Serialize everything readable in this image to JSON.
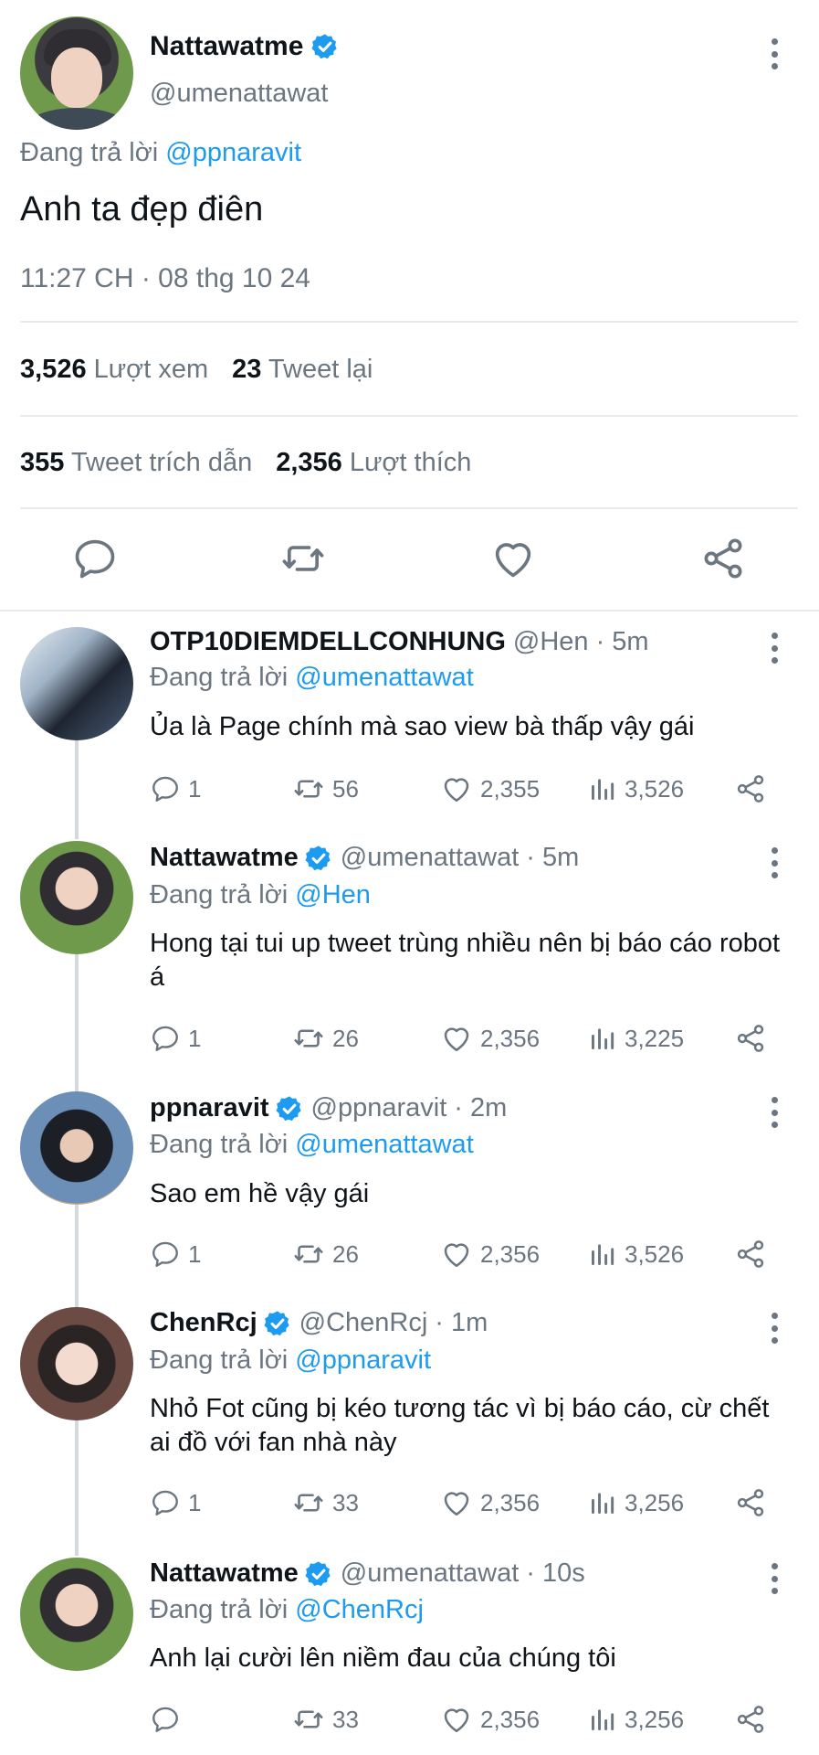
{
  "main_tweet": {
    "name": "Nattawatme",
    "handle": "@umenattawat",
    "reply_prefix": "Đang trả lời",
    "reply_to": "@ppnaravit",
    "text": "Anh ta đẹp điên",
    "timestamp": "11:27 CH · 08 thg 10 24",
    "views_count": "3,526",
    "views_label": "Lượt xem",
    "retweets_count": "23",
    "retweets_label": "Tweet lại",
    "quotes_count": "355",
    "quotes_label": "Tweet trích dẫn",
    "likes_count": "2,356",
    "likes_label": "Lượt thích",
    "actions": [
      "reply-icon",
      "retweet-icon",
      "like-icon",
      "share-icon"
    ]
  },
  "replies": [
    {
      "name": "OTP10DIEMDELLCONHUNG",
      "verified": false,
      "handle": "@Hen",
      "time": "· 5m",
      "reply_prefix": "Đang trả lời",
      "reply_to": "@umenattawat",
      "text": "Ủa là Page chính mà sao view bà thấp vậy gái",
      "replies": "1",
      "retweets": "56",
      "likes": "2,355",
      "views": "3,526"
    },
    {
      "name": "Nattawatme",
      "verified": true,
      "handle": "@umenattawat",
      "time": "· 5m",
      "reply_prefix": "Đang trả lời",
      "reply_to": "@Hen",
      "text": "Hong tại tui up tweet trùng nhiều nên bị báo cáo robot á",
      "replies": "1",
      "retweets": "26",
      "likes": "2,356",
      "views": "3,225"
    },
    {
      "name": "ppnaravit",
      "verified": true,
      "handle": "@ppnaravit",
      "time": "· 2m",
      "reply_prefix": "Đang trả lời",
      "reply_to": "@umenattawat",
      "text": "Sao em hề vậy gái",
      "replies": "1",
      "retweets": "26",
      "likes": "2,356",
      "views": "3,526"
    },
    {
      "name": "ChenRcj",
      "verified": true,
      "handle": "@ChenRcj",
      "time": "· 1m",
      "reply_prefix": "Đang trả lời",
      "reply_to": "@ppnaravit",
      "text": "Nhỏ Fot cũng bị kéo tương tác vì bị báo cáo, cừ chết ai đồ với fan nhà này",
      "replies": "1",
      "retweets": "33",
      "likes": "2,356",
      "views": "3,256"
    },
    {
      "name": "Nattawatme",
      "verified": true,
      "handle": "@umenattawat",
      "time": "· 10s",
      "reply_prefix": "Đang trả lời",
      "reply_to": "@ChenRcj",
      "text": "Anh lại cười lên niềm đau của chúng tôi",
      "replies": "",
      "retweets": "33",
      "likes": "2,356",
      "views": "3,256"
    }
  ],
  "colors": {
    "link": "#1d9bf0",
    "verified": "#1d9bf0",
    "secondary_text": "#6b7680",
    "divider": "#e6ebef"
  }
}
